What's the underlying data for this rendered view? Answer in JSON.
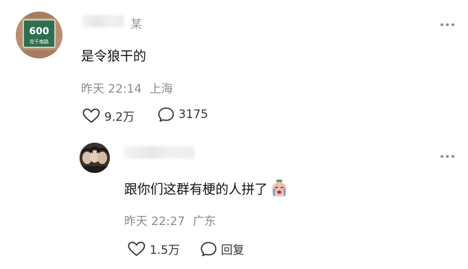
{
  "comment": {
    "avatar_sign": {
      "number": "600",
      "street": "花千南路"
    },
    "username_tail": "某",
    "text": "是令狼干的",
    "time": "昨天 22:14",
    "location": "上海",
    "likes": "9.2万",
    "replies": "3175"
  },
  "reply": {
    "text": "跟你们这群有梗的人拼了",
    "time": "昨天 22:27",
    "location": "广东",
    "likes": "1.5万",
    "reply_label": "回复"
  },
  "icons": {
    "heart": "heart-icon",
    "comment": "comment-bubble-icon",
    "more": "more-dots-icon",
    "emoji": "crying-face-emoji"
  }
}
